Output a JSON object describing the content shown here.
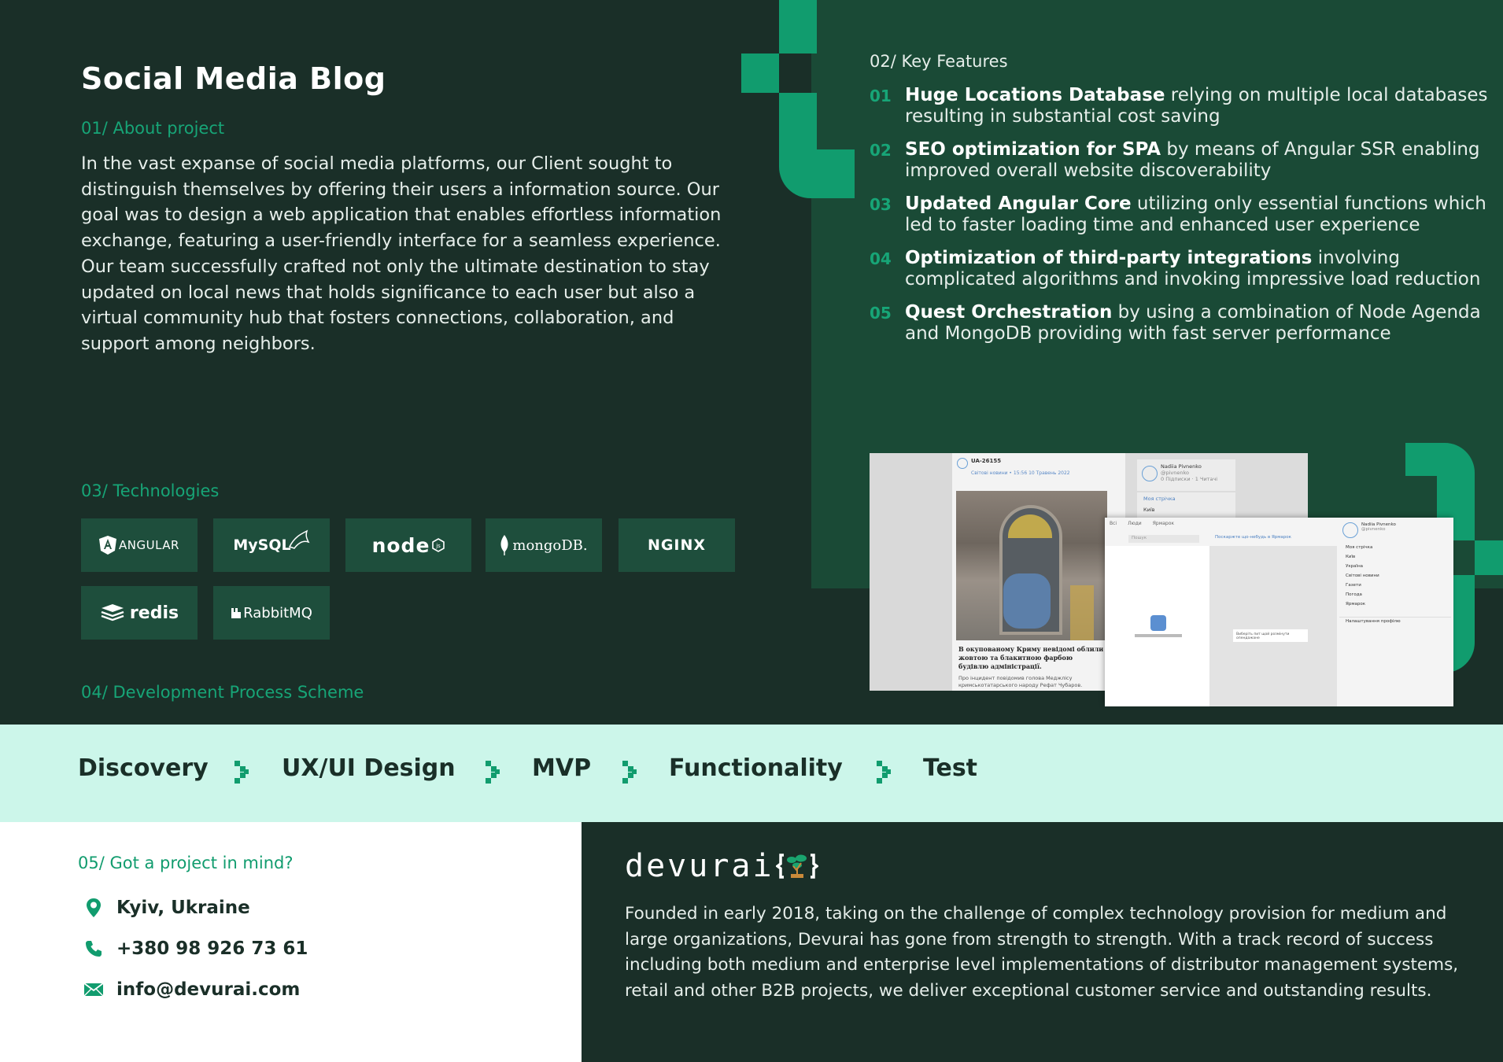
{
  "title": "Social Media Blog",
  "about": {
    "label": "01/ About project",
    "text": "In the vast expanse of social media platforms, our Client sought to distinguish themselves by offering their users a information source. Our goal was to design a web application that enables effortless information exchange, featuring a user-friendly interface for a seamless experience. Our team successfully crafted not only the ultimate destination to stay updated on local news that holds significance to each user but also a virtual community hub that fosters connections, collaboration, and support among neighbors."
  },
  "features": {
    "label": "02/ Key Features",
    "items": [
      {
        "num": "01",
        "bold": "Huge Locations Database",
        "rest": " relying on multiple local databases resulting in substantial cost saving"
      },
      {
        "num": "02",
        "bold": "SEO optimization for SPA",
        "rest": " by means of Angular SSR enabling improved overall website discoverability"
      },
      {
        "num": "03",
        "bold": "Updated Angular Core",
        "rest": " utilizing only essential functions which led to faster loading time and enhanced user experience"
      },
      {
        "num": "04",
        "bold": "Optimization of third-party integrations",
        "rest": " involving complicated algorithms and invoking impressive load reduction"
      },
      {
        "num": "05",
        "bold": "Quest Orchestration",
        "rest": " by using a combination of Node Agenda and MongoDB providing with fast server performance"
      }
    ]
  },
  "technologies": {
    "label": "03/ Technologies",
    "items": [
      "ANGULAR",
      "MySQL",
      "node",
      "mongoDB.",
      "NGINX",
      "redis",
      "RabbitMQ"
    ]
  },
  "process": {
    "label": "04/ Development Process Scheme",
    "steps": [
      "Discovery",
      "UX/UI Design",
      "MVP",
      "Functionality",
      "Test"
    ]
  },
  "screenshot": {
    "post_id": "UA-26155",
    "meta": "Світові новини • 15:56 10 Травень 2022",
    "headline": "В окупованому Криму невідомі облили жовтою та блакитною фарбою будівлю адміністрації.",
    "excerpt": "Про інцидент повідомив голова Меджлісу кримськотатарського народу Рефат Чубаров.",
    "profile_name": "Nadiia Pivnenko",
    "profile_handle": "@pivnenko",
    "profile_stats": "0 Підписки · 1 Читачі",
    "menu_1": "Моя стрічка",
    "menu_2": "Київ",
    "tabs": [
      "Всі",
      "Люди",
      "Ярмарок"
    ],
    "search_placeholder": "Пошук",
    "post_prompt": "Поскаржте що-небудь в Ярмарок",
    "empty_text": "Виберіть пит щой розмінути опендажане",
    "sidebar_items": [
      "Моя стрічка",
      "Київ",
      "Україна",
      "Світові новини",
      "Газети",
      "Погода",
      "Ярмарок"
    ],
    "settings": "Налаштування профілю"
  },
  "contact": {
    "label": "05/ Got a project in mind?",
    "location": "Kyiv, Ukraine",
    "phone": "+380 98 926 73 61",
    "email": "info@devurai.com"
  },
  "company": {
    "logo_text": "devurai",
    "text": "Founded in early 2018, taking on the challenge of complex technology provision for medium and large organizations, Devurai has gone from strength to strength. With a track record of success including both medium and enterprise level implementations of distributor management systems, retail and other B2B projects, we deliver exceptional customer service and outstanding results."
  },
  "colors": {
    "dark_bg": "#1a2f28",
    "feature_panel": "#1a4a36",
    "accent": "#119c6e",
    "process_bg": "#ccf6ea"
  }
}
